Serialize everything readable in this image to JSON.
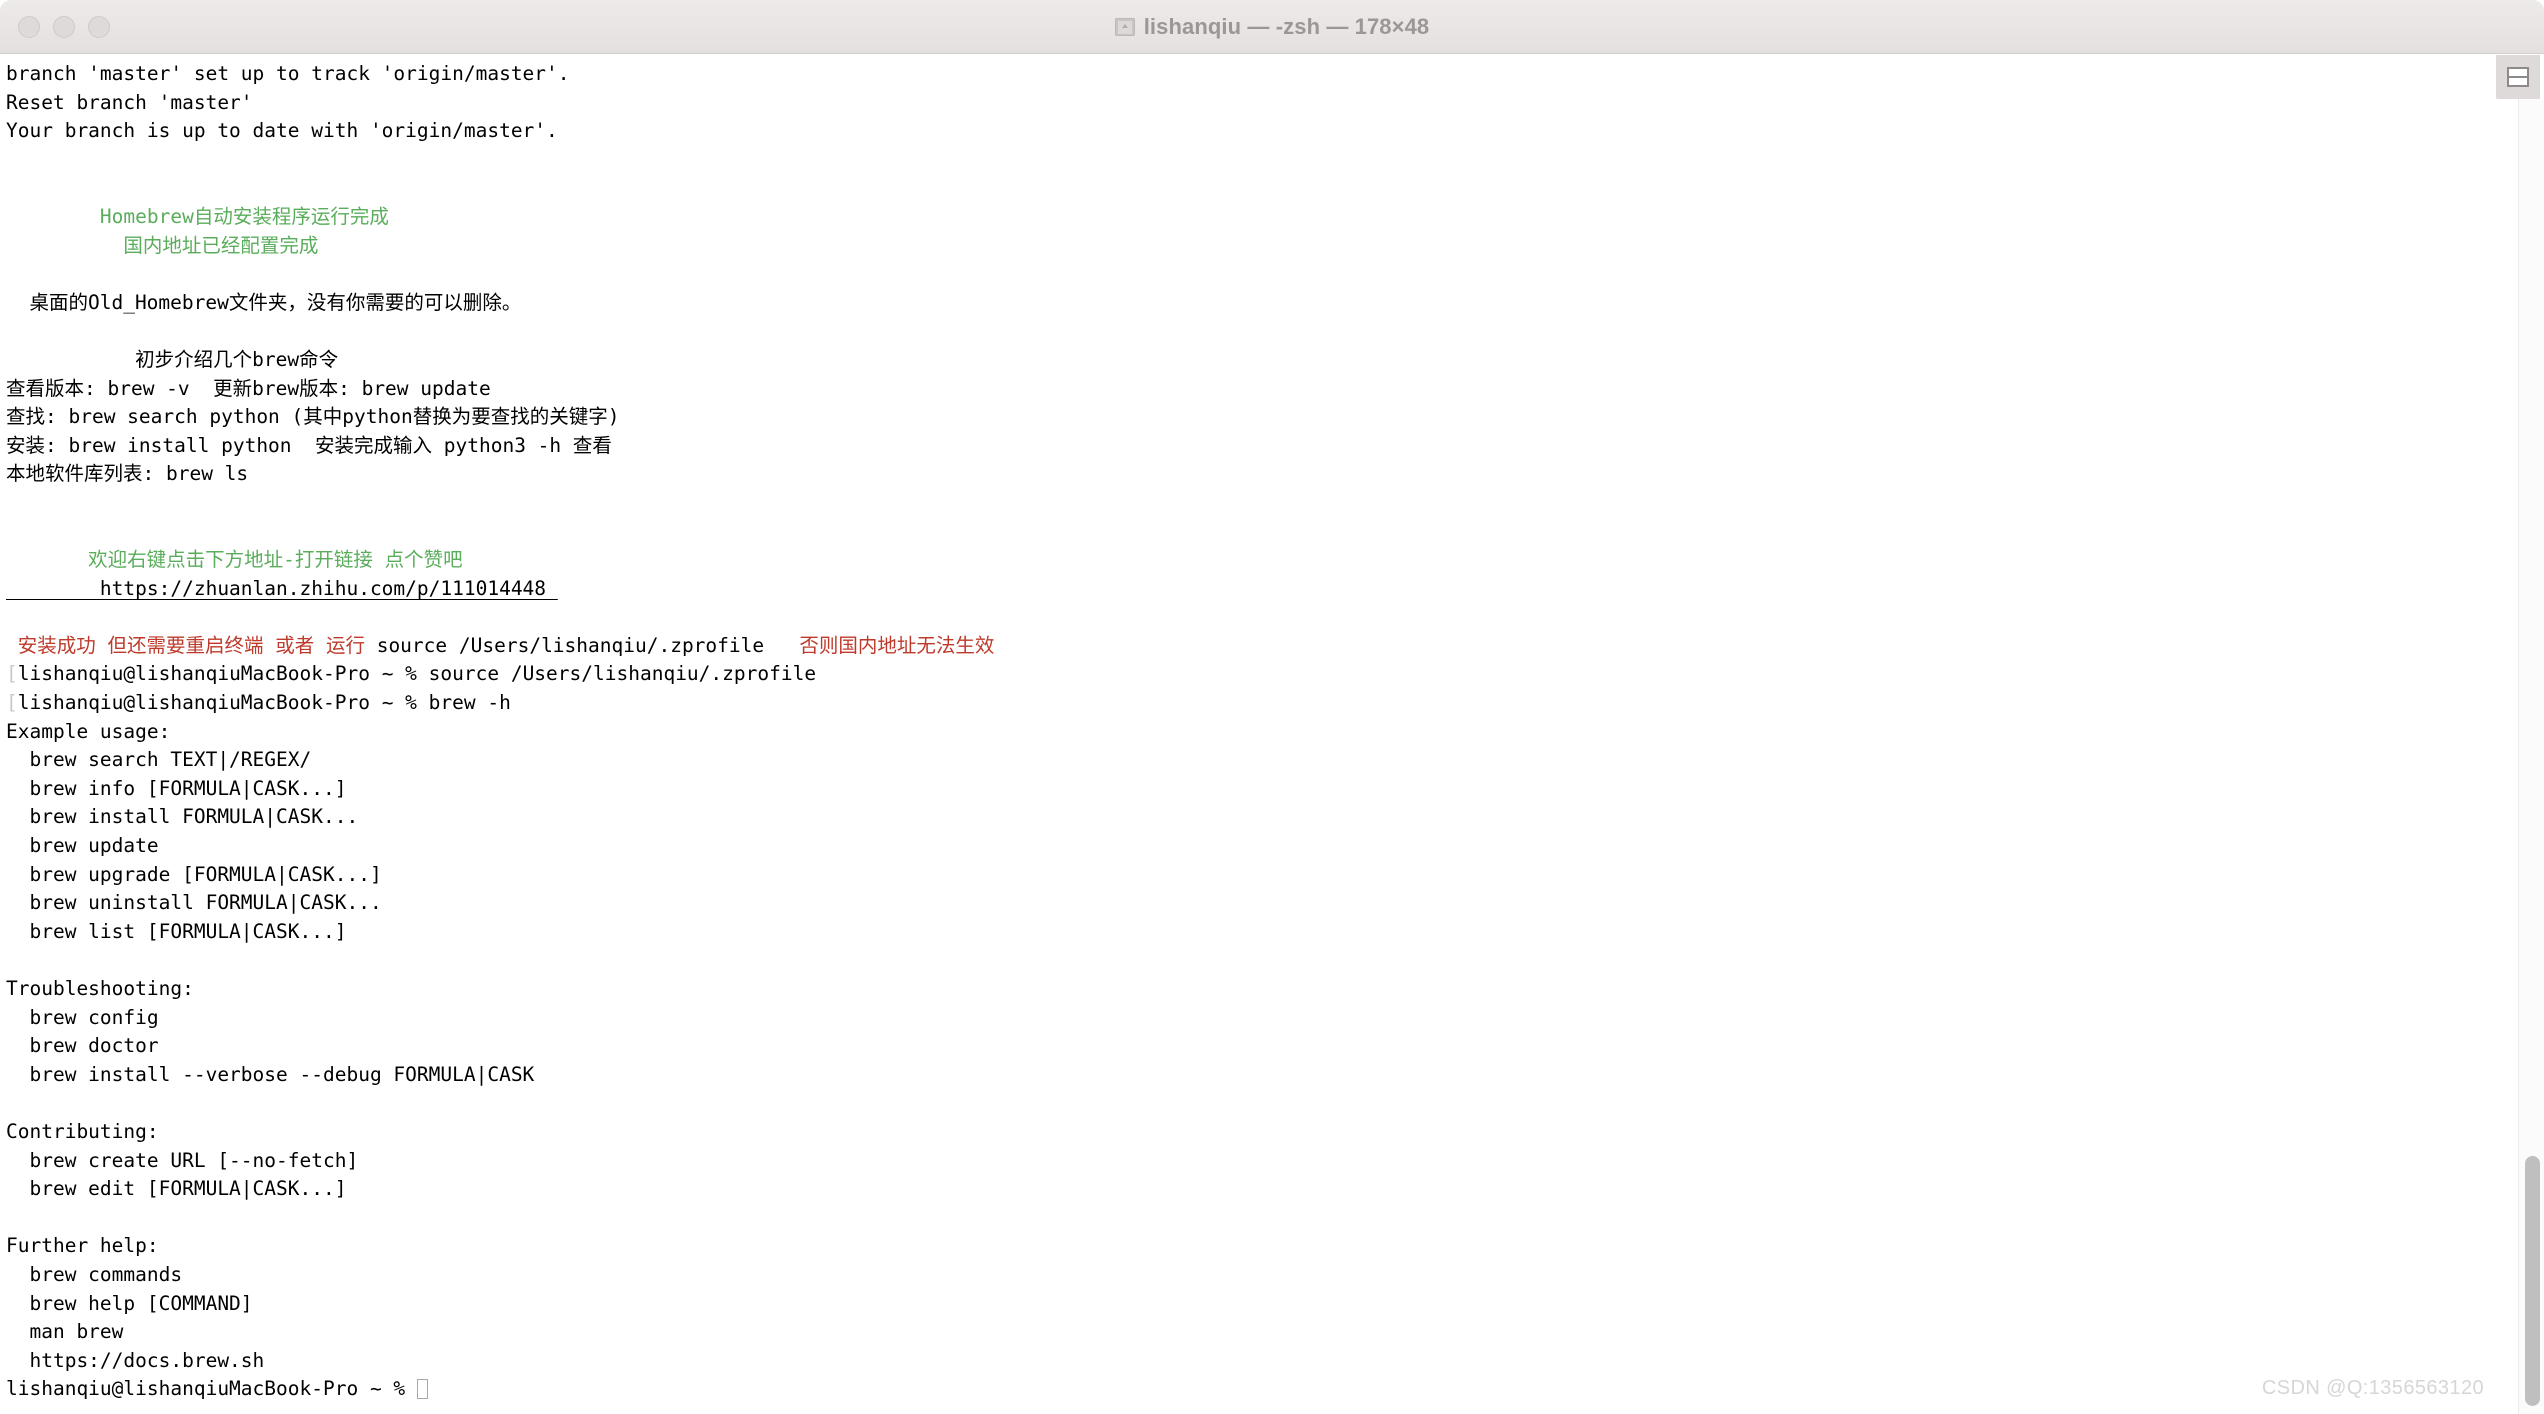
{
  "window": {
    "title": "lishanqiu — -zsh — 178×48",
    "folder_icon": "home-folder-icon",
    "traffic_lights": [
      "close-button",
      "minimize-button",
      "zoom-button"
    ]
  },
  "colors": {
    "background": "#ffffff",
    "foreground": "#000000",
    "green": "#5aad5b",
    "red": "#bf3a2b",
    "prompt_mark": "#c9c9c9",
    "titlebar": "#e9e5e4",
    "title_text": "#9b9796",
    "scrollbar_thumb": "#bfbfbf",
    "watermark": "#d6d6d6"
  },
  "toolbar": {
    "split_pane_icon": "split-pane-icon"
  },
  "scrollbar": {
    "position": "bottom"
  },
  "watermark": "CSDN @Q:1356563120",
  "terminal": {
    "lines": [
      {
        "id": "l01",
        "text": "branch 'master' set up to track 'origin/master'."
      },
      {
        "id": "l02",
        "text": "Reset branch 'master'"
      },
      {
        "id": "l03",
        "text": "Your branch is up to date with 'origin/master'."
      },
      {
        "id": "l04",
        "text": ""
      },
      {
        "id": "l05",
        "text": ""
      },
      {
        "id": "l06",
        "text": "        Homebrew自动安装程序运行完成",
        "color": "green"
      },
      {
        "id": "l07",
        "text": "          国内地址已经配置完成",
        "color": "green"
      },
      {
        "id": "l08",
        "text": ""
      },
      {
        "id": "l09",
        "text": "  桌面的Old_Homebrew文件夹，没有你需要的可以删除。"
      },
      {
        "id": "l10",
        "text": ""
      },
      {
        "id": "l11",
        "text": "           初步介绍几个brew命令"
      },
      {
        "id": "l12",
        "text": "查看版本: brew -v  更新brew版本: brew update"
      },
      {
        "id": "l13",
        "text": "查找: brew search python (其中python替换为要查找的关键字)"
      },
      {
        "id": "l14",
        "text": "安装: brew install python  安装完成输入 python3 -h 查看"
      },
      {
        "id": "l15",
        "text": "本地软件库列表: brew ls"
      },
      {
        "id": "l16",
        "text": ""
      },
      {
        "id": "l17",
        "text": ""
      },
      {
        "id": "l18",
        "text": "       欢迎右键点击下方地址-打开链接 点个赞吧",
        "color": "green"
      },
      {
        "id": "l19",
        "text": "        https://zhuanlan.zhihu.com/p/111014448 ",
        "underline": true
      },
      {
        "id": "l20",
        "text": ""
      },
      {
        "id": "l21",
        "segments": [
          {
            "text": " 安装成功 但还需要重启终端 或者 运行 ",
            "color": "red"
          },
          {
            "text": "source /Users/lishanqiu/.zprofile",
            "color": "black"
          },
          {
            "text": "   否则国内地址无法生效",
            "color": "red"
          }
        ]
      },
      {
        "id": "l22",
        "prompt": true,
        "start_mark": "[",
        "end_mark": "]",
        "text": "lishanqiu@lishanqiuMacBook-Pro ~ % source /Users/lishanqiu/.zprofile"
      },
      {
        "id": "l23",
        "prompt": true,
        "start_mark": "[",
        "end_mark": "]",
        "text": "lishanqiu@lishanqiuMacBook-Pro ~ % brew -h"
      },
      {
        "id": "l24",
        "text": "Example usage:"
      },
      {
        "id": "l25",
        "text": "  brew search TEXT|/REGEX/"
      },
      {
        "id": "l26",
        "text": "  brew info [FORMULA|CASK...]"
      },
      {
        "id": "l27",
        "text": "  brew install FORMULA|CASK..."
      },
      {
        "id": "l28",
        "text": "  brew update"
      },
      {
        "id": "l29",
        "text": "  brew upgrade [FORMULA|CASK...]"
      },
      {
        "id": "l30",
        "text": "  brew uninstall FORMULA|CASK..."
      },
      {
        "id": "l31",
        "text": "  brew list [FORMULA|CASK...]"
      },
      {
        "id": "l32",
        "text": ""
      },
      {
        "id": "l33",
        "text": "Troubleshooting:"
      },
      {
        "id": "l34",
        "text": "  brew config"
      },
      {
        "id": "l35",
        "text": "  brew doctor"
      },
      {
        "id": "l36",
        "text": "  brew install --verbose --debug FORMULA|CASK"
      },
      {
        "id": "l37",
        "text": ""
      },
      {
        "id": "l38",
        "text": "Contributing:"
      },
      {
        "id": "l39",
        "text": "  brew create URL [--no-fetch]"
      },
      {
        "id": "l40",
        "text": "  brew edit [FORMULA|CASK...]"
      },
      {
        "id": "l41",
        "text": ""
      },
      {
        "id": "l42",
        "text": "Further help:"
      },
      {
        "id": "l43",
        "text": "  brew commands"
      },
      {
        "id": "l44",
        "text": "  brew help [COMMAND]"
      },
      {
        "id": "l45",
        "text": "  man brew"
      },
      {
        "id": "l46",
        "text": "  https://docs.brew.sh"
      },
      {
        "id": "l47",
        "text": "lishanqiu@lishanqiuMacBook-Pro ~ % ",
        "cursor": true
      }
    ]
  }
}
